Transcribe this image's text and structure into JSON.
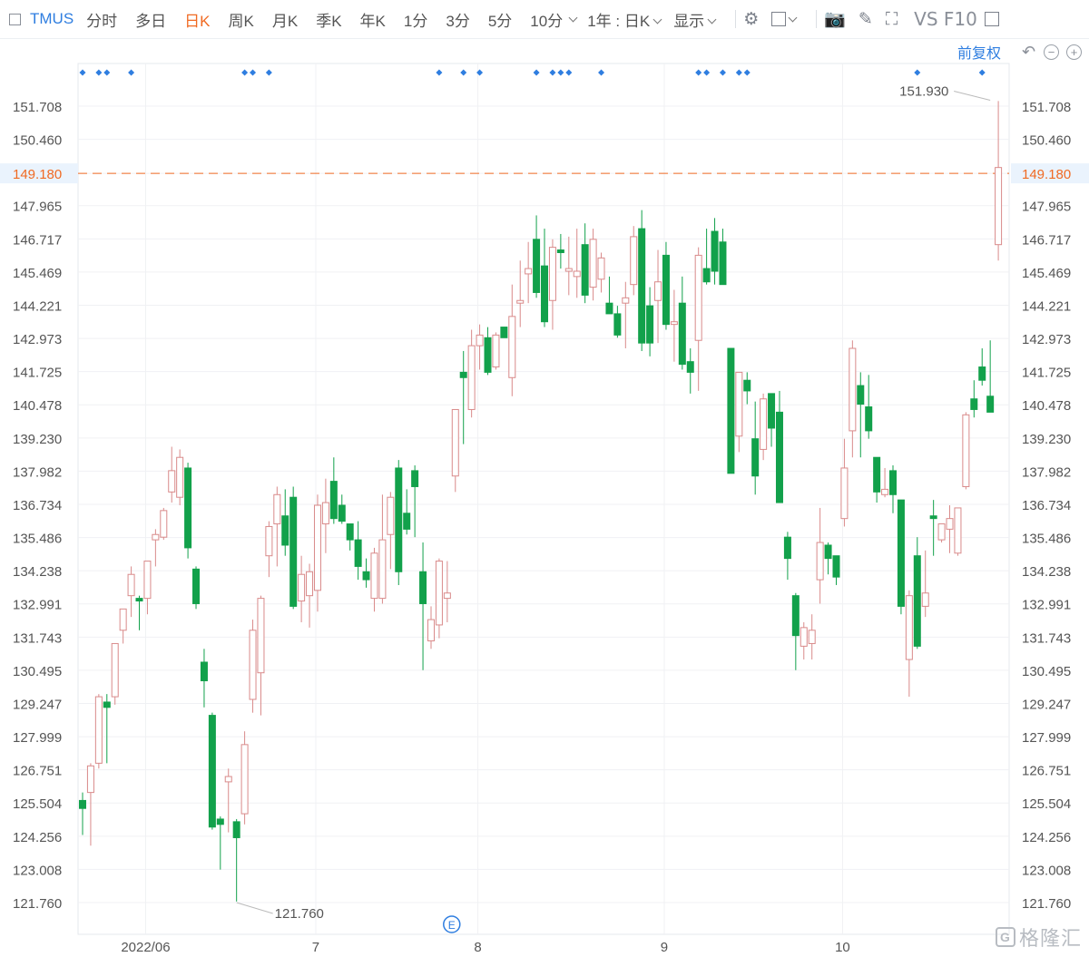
{
  "toolbar": {
    "symbol": "TMUS",
    "periods": [
      "分时",
      "多日",
      "日K",
      "周K",
      "月K",
      "季K",
      "年K",
      "1分",
      "3分",
      "5分",
      "10分"
    ],
    "active_period": "日K",
    "range_selector": "1年 : 日K",
    "display_label": "显示",
    "vs_label": "VS F10",
    "icons": [
      "settings-icon",
      "rectangle-icon",
      "camera-icon",
      "pencil-icon",
      "fullscreen-icon"
    ]
  },
  "adjust": {
    "label": "前复权",
    "icons": [
      "undo-icon",
      "zoom-out-icon",
      "zoom-in-icon"
    ]
  },
  "watermark": {
    "text": "格隆汇",
    "logo": "G"
  },
  "event_marker": "E",
  "colors": {
    "up": "#d98a8a",
    "down": "#12a14b",
    "marker": "#2f7ee0",
    "current_price": "#f06a22"
  },
  "chart_data": {
    "type": "candlestick",
    "y_ticks": [
      151.708,
      150.46,
      149.18,
      147.965,
      146.717,
      145.469,
      144.221,
      142.973,
      141.725,
      140.478,
      139.23,
      137.982,
      136.734,
      135.486,
      134.238,
      132.991,
      131.743,
      130.495,
      129.247,
      127.999,
      126.751,
      125.504,
      124.256,
      123.008,
      121.76
    ],
    "y_tick_labels": [
      "151.708",
      "150.460",
      "149.180",
      "147.965",
      "146.717",
      "145.469",
      "144.221",
      "142.973",
      "141.725",
      "140.478",
      "139.230",
      "137.982",
      "136.734",
      "135.486",
      "134.238",
      "132.991",
      "131.743",
      "130.495",
      "129.247",
      "127.999",
      "126.751",
      "125.504",
      "124.256",
      "123.008",
      "121.760"
    ],
    "ylim": [
      121.2,
      152.4
    ],
    "current_price": 149.18,
    "current_price_label": "149.180",
    "annotations": [
      {
        "label": "151.930",
        "value": 151.93,
        "index": 112
      },
      {
        "label": "121.760",
        "value": 121.76,
        "index": 19
      }
    ],
    "x_tick_labels": [
      {
        "label": "2022/06",
        "index": 8
      },
      {
        "label": "7",
        "index": 29
      },
      {
        "label": "8",
        "index": 49
      },
      {
        "label": "9",
        "index": 72
      },
      {
        "label": "10",
        "index": 94
      }
    ],
    "event_index": 46,
    "marker_indices": [
      0,
      2,
      3,
      6,
      20,
      21,
      23,
      44,
      47,
      49,
      56,
      58,
      59,
      60,
      64,
      76,
      77,
      79,
      81,
      82,
      103,
      111
    ],
    "candles": [
      [
        125.6,
        125.9,
        124.3,
        125.3
      ],
      [
        125.9,
        127.0,
        123.9,
        126.9
      ],
      [
        127.0,
        129.6,
        126.8,
        129.5
      ],
      [
        129.3,
        129.6,
        127.0,
        129.1
      ],
      [
        129.5,
        131.5,
        129.2,
        131.5
      ],
      [
        132.0,
        132.8,
        131.5,
        132.8
      ],
      [
        133.3,
        134.4,
        132.5,
        134.1
      ],
      [
        133.2,
        133.3,
        132.0,
        133.1
      ],
      [
        133.2,
        134.6,
        132.6,
        134.6
      ],
      [
        135.4,
        135.8,
        134.4,
        135.6
      ],
      [
        135.5,
        136.6,
        135.4,
        136.5
      ],
      [
        137.2,
        138.9,
        136.8,
        138.0
      ],
      [
        137.0,
        138.8,
        136.7,
        138.5
      ],
      [
        138.1,
        138.3,
        134.7,
        135.1
      ],
      [
        134.3,
        134.4,
        132.8,
        133.0
      ],
      [
        130.8,
        131.3,
        129.1,
        130.1
      ],
      [
        128.8,
        128.9,
        124.5,
        124.6
      ],
      [
        124.9,
        125.0,
        123.0,
        124.7
      ],
      [
        126.3,
        126.8,
        124.4,
        126.5
      ],
      [
        124.8,
        124.9,
        121.8,
        124.2
      ],
      [
        125.1,
        128.2,
        124.7,
        127.7
      ],
      [
        129.4,
        132.4,
        128.9,
        132.0
      ],
      [
        130.4,
        133.3,
        128.8,
        133.2
      ],
      [
        134.8,
        136.1,
        134.0,
        135.9
      ],
      [
        136.0,
        137.4,
        134.4,
        137.1
      ],
      [
        136.3,
        137.3,
        134.8,
        135.2
      ],
      [
        137.0,
        137.4,
        132.8,
        132.9
      ],
      [
        133.1,
        134.8,
        132.3,
        134.1
      ],
      [
        133.3,
        134.5,
        132.1,
        134.2
      ],
      [
        133.5,
        137.1,
        132.7,
        136.7
      ],
      [
        136.0,
        137.7,
        134.9,
        136.8
      ],
      [
        137.6,
        138.5,
        136.0,
        136.2
      ],
      [
        136.7,
        137.1,
        136.0,
        136.1
      ],
      [
        136.0,
        136.0,
        135.0,
        135.4
      ],
      [
        135.4,
        136.1,
        133.9,
        134.4
      ],
      [
        134.2,
        134.7,
        133.6,
        133.9
      ],
      [
        133.2,
        135.1,
        132.7,
        134.9
      ],
      [
        133.2,
        137.1,
        133.0,
        135.4
      ],
      [
        135.6,
        137.2,
        134.3,
        137.0
      ],
      [
        138.1,
        138.4,
        133.7,
        134.2
      ],
      [
        136.4,
        137.3,
        135.6,
        135.8
      ],
      [
        138.0,
        138.2,
        135.5,
        137.4
      ],
      [
        134.2,
        135.3,
        130.5,
        133.0
      ],
      [
        131.6,
        132.9,
        131.3,
        132.4
      ],
      [
        132.2,
        134.7,
        131.7,
        134.6
      ],
      [
        133.2,
        134.6,
        132.3,
        133.4
      ],
      [
        137.8,
        140.1,
        137.2,
        140.3
      ],
      [
        141.7,
        142.5,
        139.0,
        141.5
      ],
      [
        140.3,
        143.3,
        140.0,
        142.7
      ],
      [
        142.7,
        143.5,
        141.8,
        143.1
      ],
      [
        143.0,
        143.4,
        141.6,
        141.7
      ],
      [
        141.9,
        143.2,
        141.8,
        143.1
      ],
      [
        143.4,
        143.3,
        143.6,
        143.0
      ],
      [
        141.5,
        145.0,
        140.8,
        143.8
      ],
      [
        144.3,
        145.9,
        143.4,
        144.4
      ],
      [
        145.4,
        146.6,
        144.3,
        145.6
      ],
      [
        146.7,
        147.6,
        144.5,
        144.7
      ],
      [
        145.7,
        147.1,
        143.4,
        143.6
      ],
      [
        144.4,
        146.7,
        143.3,
        146.4
      ],
      [
        146.3,
        146.9,
        145.6,
        146.2
      ],
      [
        145.5,
        146.8,
        144.6,
        145.6
      ],
      [
        145.3,
        147.1,
        144.5,
        145.5
      ],
      [
        146.5,
        147.3,
        144.3,
        144.6
      ],
      [
        144.9,
        147.1,
        144.4,
        146.7
      ],
      [
        145.2,
        146.2,
        144.7,
        146.0
      ],
      [
        144.3,
        145.3,
        143.9,
        143.9
      ],
      [
        143.9,
        144.2,
        143.0,
        143.1
      ],
      [
        144.3,
        145.1,
        142.6,
        144.5
      ],
      [
        145.0,
        147.2,
        144.6,
        146.8
      ],
      [
        147.1,
        147.8,
        142.5,
        142.8
      ],
      [
        144.2,
        144.9,
        142.3,
        142.8
      ],
      [
        144.4,
        146.3,
        142.8,
        145.1
      ],
      [
        146.1,
        146.6,
        143.3,
        143.5
      ],
      [
        143.5,
        144.8,
        142.1,
        143.6
      ],
      [
        144.3,
        145.3,
        141.8,
        142.0
      ],
      [
        142.1,
        142.6,
        140.9,
        141.7
      ],
      [
        142.9,
        146.4,
        141.0,
        146.1
      ],
      [
        145.6,
        147.1,
        145.0,
        145.1
      ],
      [
        147.0,
        147.5,
        145.0,
        145.5
      ],
      [
        146.6,
        147.1,
        145.0,
        145.0
      ],
      [
        142.6,
        142.6,
        138.1,
        137.9
      ],
      [
        139.3,
        141.7,
        138.7,
        141.7
      ],
      [
        141.4,
        141.7,
        140.5,
        141.0
      ],
      [
        139.2,
        140.6,
        137.1,
        137.8
      ],
      [
        138.8,
        140.9,
        138.4,
        140.7
      ],
      [
        140.9,
        140.7,
        138.9,
        139.6
      ],
      [
        140.2,
        141.0,
        136.8,
        136.8
      ],
      [
        135.5,
        135.7,
        133.9,
        134.7
      ],
      [
        133.3,
        133.4,
        130.5,
        131.8
      ],
      [
        131.4,
        132.3,
        130.9,
        132.1
      ],
      [
        131.5,
        132.6,
        130.9,
        132.0
      ],
      [
        133.9,
        136.6,
        133.0,
        135.3
      ],
      [
        135.2,
        135.3,
        134.1,
        134.7
      ],
      [
        134.8,
        134.8,
        133.7,
        134.0
      ],
      [
        136.2,
        139.2,
        135.9,
        138.1
      ],
      [
        139.5,
        142.9,
        138.5,
        142.6
      ],
      [
        141.2,
        141.7,
        138.5,
        140.5
      ],
      [
        140.4,
        141.6,
        139.2,
        139.5
      ],
      [
        138.5,
        138.4,
        136.8,
        137.2
      ],
      [
        137.1,
        138.1,
        137.0,
        137.3
      ],
      [
        138.0,
        138.2,
        136.4,
        137.1
      ],
      [
        136.9,
        136.9,
        132.6,
        132.9
      ],
      [
        130.9,
        133.5,
        129.5,
        133.3
      ],
      [
        134.8,
        135.5,
        131.3,
        131.4
      ],
      [
        132.9,
        135.0,
        132.5,
        133.4
      ],
      [
        136.3,
        136.9,
        134.8,
        136.2
      ],
      [
        135.4,
        136.0,
        135.3,
        136.0
      ],
      [
        135.8,
        136.7,
        134.9,
        136.2
      ],
      [
        134.9,
        136.3,
        134.8,
        136.6
      ],
      [
        137.4,
        140.2,
        137.3,
        140.1
      ],
      [
        140.7,
        141.4,
        140.0,
        140.3
      ],
      [
        141.9,
        142.6,
        141.2,
        141.4
      ],
      [
        140.8,
        142.9,
        140.3,
        140.2
      ],
      [
        146.5,
        151.9,
        145.9,
        149.4
      ]
    ]
  }
}
